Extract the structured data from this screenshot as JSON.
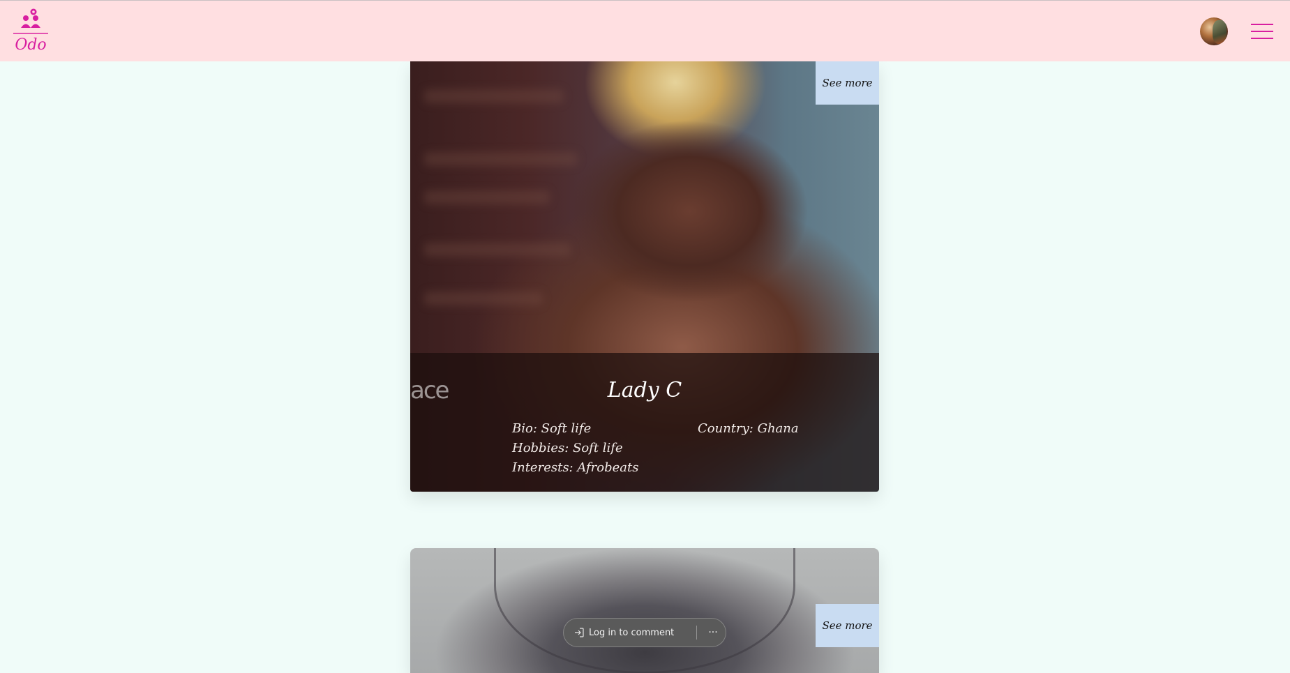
{
  "header": {
    "logo_text": "Odo",
    "avatar_icon": "user-avatar",
    "menu_icon": "hamburger-menu-icon",
    "accent_color": "#d81fa0",
    "background": "#ffdfe1"
  },
  "cards": [
    {
      "see_more": "See more",
      "watermark": "ace",
      "name": "Lady C",
      "bio": "Bio: Soft life",
      "hobbies": "Hobbies: Soft life",
      "interests": "Interests: Afrobeats",
      "country": "Country: Ghana"
    },
    {
      "see_more": "See more"
    }
  ],
  "comment_bar": {
    "login_label": "Log in to comment",
    "login_icon": "sign-in-icon",
    "more_label": "···"
  }
}
